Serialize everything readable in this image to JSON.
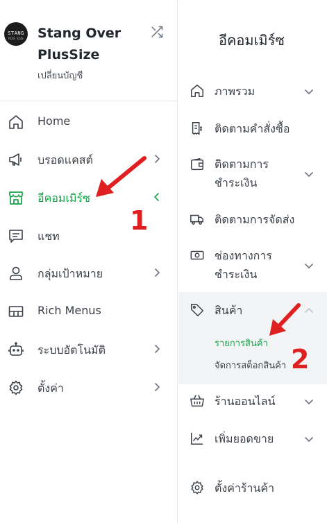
{
  "account": {
    "logo_text": "STANG",
    "logo_subtext": "PLUS SIZE",
    "name": "Stang Over PlusSize",
    "switch_label": "เปลี่ยนบัญชี"
  },
  "sidebar": {
    "items": [
      {
        "label": "Home",
        "icon": "home-icon"
      },
      {
        "label": "บรอดแคสต์",
        "icon": "megaphone-icon"
      },
      {
        "label": "อีคอมเมิร์ซ",
        "icon": "store-icon",
        "active": true
      },
      {
        "label": "แชท",
        "icon": "chat-icon"
      },
      {
        "label": "กลุ่มเป้าหมาย",
        "icon": "user-icon"
      },
      {
        "label": "Rich Menus",
        "icon": "rich-menu-icon"
      },
      {
        "label": "ระบบอัตโนมัติ",
        "icon": "bot-icon"
      },
      {
        "label": "ตั้งค่า",
        "icon": "gear-icon"
      }
    ]
  },
  "panel": {
    "title": "อีคอมเมิร์ซ",
    "items": [
      {
        "label": "ภาพรวม",
        "icon": "home-icon"
      },
      {
        "label": "ติดตามคำสั่งซื้อ",
        "icon": "receipt-icon"
      },
      {
        "label": "ติดตามการชำระเงิน",
        "icon": "wallet-icon"
      },
      {
        "label": "ติดตามการจัดส่ง",
        "icon": "truck-icon"
      },
      {
        "label": "ช่องทางการชำระเงิน",
        "icon": "cash-icon"
      },
      {
        "label": "สินค้า",
        "icon": "tag-icon",
        "expanded": true
      },
      {
        "label": "ร้านออนไลน์",
        "icon": "basket-icon"
      },
      {
        "label": "เพิ่มยอดขาย",
        "icon": "growth-chart-icon"
      },
      {
        "label": "ตั้งค่าร้านค้า",
        "icon": "gear-icon"
      }
    ],
    "product_sub": {
      "list_label": "รายการสินค้า",
      "stock_label": "จัดการสต็อกสินค้า"
    }
  },
  "annotations": {
    "step1": "1",
    "step2": "2",
    "color": "#e02020"
  },
  "colors": {
    "accent_green": "#16a34a",
    "panel_highlight": "#f3f4f6"
  }
}
